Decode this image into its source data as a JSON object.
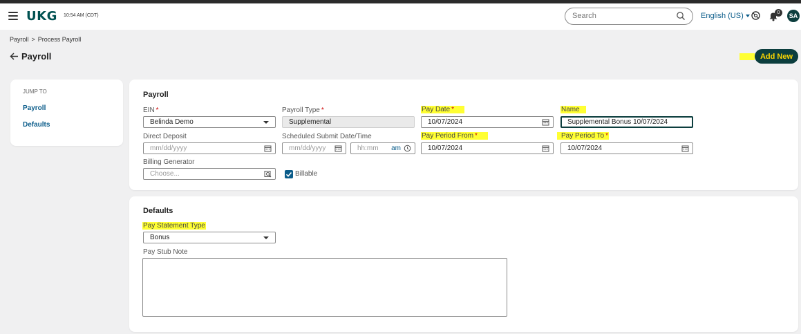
{
  "header": {
    "logo": "UKG",
    "time": "10:54 AM (CDT)",
    "search_placeholder": "Search",
    "language": "English (US)",
    "notification_count": "0",
    "avatar_initials": "SA"
  },
  "breadcrumb": {
    "items": [
      "Payroll",
      "Process Payroll"
    ],
    "separator": ">"
  },
  "page": {
    "title": "Payroll",
    "add_new_label": "Add New"
  },
  "jump_to": {
    "label": "JUMP TO",
    "links": [
      "Payroll",
      "Defaults"
    ]
  },
  "payroll_section": {
    "title": "Payroll",
    "ein": {
      "label": "EIN",
      "value": "Belinda Demo"
    },
    "payroll_type": {
      "label": "Payroll Type",
      "value": "Supplemental"
    },
    "pay_date": {
      "label": "Pay Date",
      "value": "10/07/2024"
    },
    "name": {
      "label": "Name",
      "value": "Supplemental Bonus 10/07/2024"
    },
    "direct_deposit": {
      "label": "Direct Deposit",
      "placeholder": "mm/dd/yyyy"
    },
    "scheduled_submit": {
      "label": "Scheduled Submit Date/Time",
      "date_placeholder": "mm/dd/yyyy",
      "time_placeholder": "hh:mm",
      "ampm": "am"
    },
    "pay_period_from": {
      "label": "Pay Period From",
      "value": "10/07/2024"
    },
    "pay_period_to": {
      "label": "Pay Period To",
      "value": "10/07/2024"
    },
    "billing_generator": {
      "label": "Billing Generator",
      "placeholder": "Choose..."
    },
    "billable": {
      "label": "Billable",
      "checked": true
    },
    "required_mark": "*"
  },
  "defaults_section": {
    "title": "Defaults",
    "pay_statement_type": {
      "label": "Pay Statement Type",
      "value": "Bonus"
    },
    "pay_stub_note": {
      "label": "Pay Stub Note",
      "value": ""
    }
  },
  "colors": {
    "brand_dark": "#0c3e3e",
    "link_blue": "#0a5c8a",
    "highlight": "#ffff33",
    "required": "#cc0000"
  }
}
